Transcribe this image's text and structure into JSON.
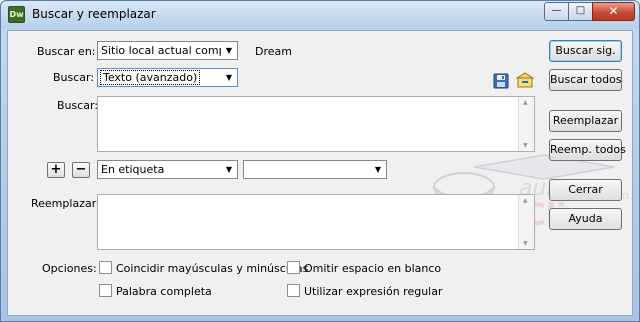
{
  "window": {
    "title": "Buscar y reemplazar",
    "app_icon": "Dw"
  },
  "form": {
    "buscar_en_label": "Buscar en:",
    "buscar_en_value": "Sitio local actual completo",
    "buscar_en_extra": "Dream",
    "buscar_label": "Buscar:",
    "buscar_type_value": "Texto (avanzado)",
    "buscar_text_label": "Buscar:",
    "tag_select_value": "En etiqueta",
    "tag_value_select": "",
    "reemplazar_label": "Reemplazar:",
    "opciones_label": "Opciones:"
  },
  "options": {
    "match_case": "Coincidir mayúsculas y minúsculas",
    "ignore_whitespace": "Omitir espacio en blanco",
    "whole_word": "Palabra completa",
    "regex": "Utilizar expresión regular"
  },
  "buttons": {
    "find_next": "Buscar sig.",
    "find_all": "Buscar todos",
    "replace": "Reemplazar",
    "replace_all": "Reemp. todos",
    "close": "Cerrar",
    "help": "Ayuda",
    "add": "+",
    "remove": "−"
  },
  "watermark": {
    "line1": "aula",
    "line2": "Clic",
    "suffix": ".com"
  }
}
